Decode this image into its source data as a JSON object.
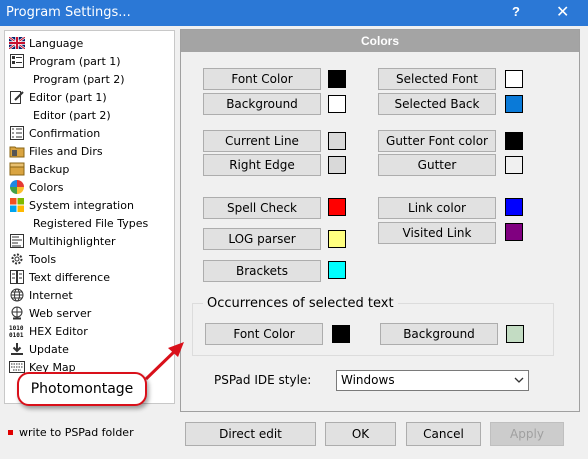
{
  "window": {
    "title": "Program Settings...",
    "help_glyph": "?",
    "close_glyph": "✕"
  },
  "sidebar": {
    "items": [
      {
        "label": "Language",
        "icon": "uk-flag-icon"
      },
      {
        "label": "Program  (part 1)",
        "icon": "program-icon"
      },
      {
        "label": "Program  (part 2)",
        "icon": ""
      },
      {
        "label": "Editor  (part 1)",
        "icon": "editor-icon"
      },
      {
        "label": "Editor  (part 2)",
        "icon": ""
      },
      {
        "label": "Confirmation",
        "icon": "checklist-icon"
      },
      {
        "label": "Files and Dirs",
        "icon": "folder-icon"
      },
      {
        "label": "Backup",
        "icon": "backup-icon"
      },
      {
        "label": "Colors",
        "icon": "palette-icon"
      },
      {
        "label": "System integration",
        "icon": "windows-icon"
      },
      {
        "label": "Registered File Types",
        "icon": ""
      },
      {
        "label": "Multihighlighter",
        "icon": "highlighter-icon"
      },
      {
        "label": "Tools",
        "icon": "gear-icon"
      },
      {
        "label": "Text difference",
        "icon": "diff-icon"
      },
      {
        "label": "Internet",
        "icon": "globe-icon"
      },
      {
        "label": "Web server",
        "icon": "web-server-icon"
      },
      {
        "label": "HEX Editor",
        "icon": "hex-icon"
      },
      {
        "label": "Update",
        "icon": "download-icon"
      },
      {
        "label": "Key Map",
        "icon": "keyboard-icon"
      }
    ],
    "selected": "Colors"
  },
  "footnote": "write to PSPad folder",
  "panel": {
    "title": "Colors",
    "left_buttons": [
      {
        "label": "Font Color",
        "color": "#000000"
      },
      {
        "label": "Background",
        "color": "#ffffff"
      },
      {
        "label": "Current Line",
        "color": "#d9d9d9"
      },
      {
        "label": "Right Edge",
        "color": "#d9d9d9"
      },
      {
        "label": "Spell Check",
        "color": "#ff0000"
      },
      {
        "label": "LOG parser",
        "color": "#ffff80"
      },
      {
        "label": "Brackets",
        "color": "#00ffff"
      }
    ],
    "right_buttons": [
      {
        "label": "Selected Font",
        "color": "#ffffff"
      },
      {
        "label": "Selected Back",
        "color": "#0a7ad8"
      },
      {
        "label": "Gutter Font color",
        "color": "#000000"
      },
      {
        "label": "Gutter",
        "color": "#f0f0f0"
      },
      {
        "label": "Link color",
        "color": "#0000ff"
      },
      {
        "label": "Visited Link",
        "color": "#800080"
      }
    ],
    "occurrences": {
      "label": "Occurrences of selected text",
      "font_color": {
        "label": "Font Color",
        "color": "#000000"
      },
      "background": {
        "label": "Background",
        "color": "#c3dcc3"
      }
    },
    "ide_style": {
      "label": "PSPad IDE style:",
      "value": "Windows"
    }
  },
  "callout": "Photomontage",
  "footer": {
    "direct_edit": "Direct edit",
    "ok": "OK",
    "cancel": "Cancel",
    "apply": "Apply"
  }
}
